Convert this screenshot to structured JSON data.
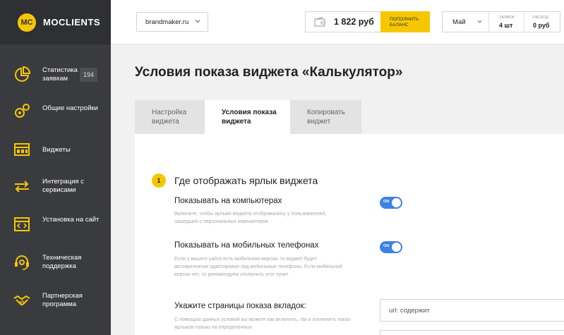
{
  "logo": {
    "badge": "MC",
    "name": "MOCLIENTS"
  },
  "sidebar": {
    "items": [
      {
        "label": "Статистика по заявкам",
        "badge": "194",
        "icon": "pie-chart-icon"
      },
      {
        "label": "Общие настройки",
        "icon": "gears-icon"
      },
      {
        "label": "Виджеты",
        "icon": "widgets-icon"
      },
      {
        "label": "Интеграция с сервисами",
        "icon": "arrows-icon"
      },
      {
        "label": "Установка на сайт",
        "icon": "code-window-icon"
      },
      {
        "label": "Техническая поддержка",
        "icon": "headset-icon"
      },
      {
        "label": "Партнерская программа",
        "icon": "handshake-icon"
      }
    ]
  },
  "topbar": {
    "site": "brandmaker.ru",
    "balance": "1 822 руб",
    "topup_label": "ПОПОЛНИТЬ БАЛАНС",
    "month": "Май",
    "requests_label": "ЗАЯВОК",
    "requests_value": "4 шт",
    "expense_label": "РАСХОД",
    "expense_value": "0 руб"
  },
  "page": {
    "title": "Условия показа виджета «Калькулятор»",
    "tabs": [
      {
        "label": "Настройка виджета",
        "active": false
      },
      {
        "label": "Условия показа виджета",
        "active": true
      },
      {
        "label": "Копировать виджет",
        "active": false
      }
    ]
  },
  "section": {
    "number": "1",
    "title": "Где отображать ярлык виджета",
    "options": [
      {
        "title": "Показывать на компьютерах",
        "desc": "Включите, чтобы ярлыки виджета отображались у пользователей, зашедших с персональных компьютеров",
        "toggle": "ON"
      },
      {
        "title": "Показывать на мобильных телефонах",
        "desc": "Если у вашего сайта есть мобильная версия, то виджет будет автоматически адаптирован под мобильные телефоны. Если мобильной версии нет, то рекомендуем отключить этот пункт",
        "toggle": "ON"
      }
    ],
    "pages_title": "Укажите страницы показа вкладок:",
    "pages_desc": "С помощью данных условий вы можете как включить, так и отключить показ ярлыков только на определенных",
    "url_placeholder": "url: содержит"
  },
  "colors": {
    "accent": "#f6c700",
    "sidebar": "#3a3b3f",
    "toggle": "#3b82e6"
  }
}
